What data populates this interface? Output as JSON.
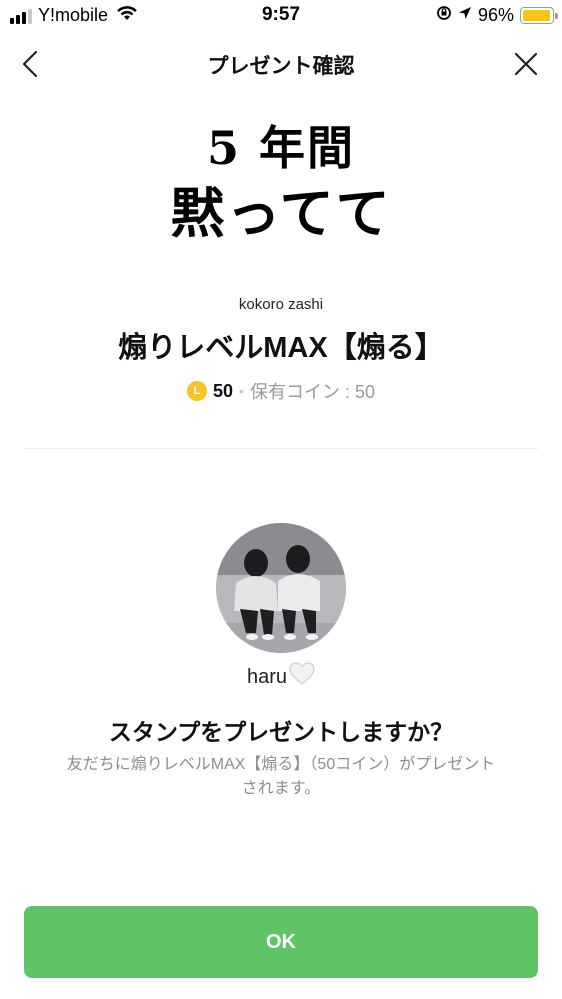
{
  "status_bar": {
    "carrier": "Y!mobile",
    "time": "9:57",
    "battery_percent": "96%",
    "battery_level": 0.96
  },
  "nav": {
    "title": "プレゼント確認",
    "back_icon": "chevron-left-icon",
    "close_icon": "close-icon"
  },
  "sticker": {
    "line1": "5 年間",
    "line2": "黙ってて"
  },
  "product": {
    "author": "kokoro zashi",
    "name": "煽りレベルMAX【煽る】",
    "coin_icon_letter": "L",
    "price": "50",
    "separator": "•",
    "owned_label": "保有コイン : 50"
  },
  "recipient": {
    "name": "haru",
    "heart_icon": "white-heart-icon"
  },
  "confirm": {
    "question": "スタンプをプレゼントしますか？",
    "description": "友だちに煽りレベルMAX【煽る】（50コイン）がプレゼントされます。"
  },
  "actions": {
    "ok_label": "OK"
  },
  "colors": {
    "ok_button": "#5fc466",
    "coin": "#f3c52a",
    "battery": "#f5c518"
  }
}
